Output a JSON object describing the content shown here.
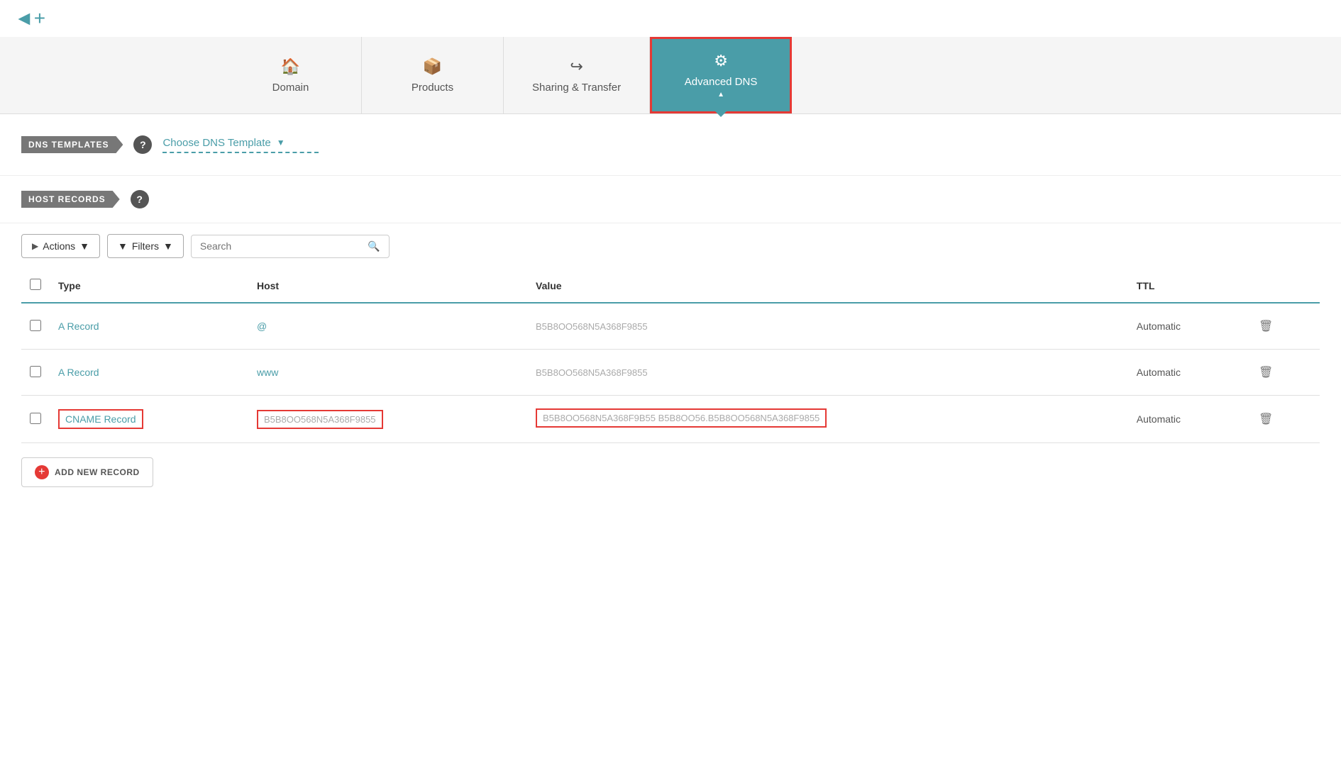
{
  "logo": {
    "arrow": "◄+"
  },
  "nav": {
    "tabs": [
      {
        "id": "domain",
        "label": "Domain",
        "icon": "🏠",
        "active": false
      },
      {
        "id": "products",
        "label": "Products",
        "icon": "📦",
        "active": false
      },
      {
        "id": "sharing-transfer",
        "label": "Sharing & Transfer",
        "icon": "🔀",
        "active": false
      },
      {
        "id": "advanced-dns",
        "label": "Advanced DNS",
        "icon": "⚙",
        "active": true
      }
    ]
  },
  "dns_templates": {
    "label": "DNS TEMPLATES",
    "placeholder": "Choose DNS Template",
    "help_title": "DNS Templates Help"
  },
  "host_records": {
    "label": "HOST RECORDS",
    "help_title": "Host Records Help"
  },
  "toolbar": {
    "actions_label": "Actions",
    "filters_label": "Filters",
    "search_placeholder": "Search"
  },
  "table": {
    "headers": [
      "",
      "Type",
      "Host",
      "Value",
      "TTL",
      ""
    ],
    "rows": [
      {
        "id": "row1",
        "type": "A Record",
        "host": "@",
        "value": "B5B8OO568N5A368F9855",
        "ttl": "Automatic",
        "highlighted": false
      },
      {
        "id": "row2",
        "type": "A Record",
        "host": "www",
        "value": "B5B8OO568N5A368F9855",
        "ttl": "Automatic",
        "highlighted": false
      },
      {
        "id": "row3",
        "type": "CNAME Record",
        "host": "B5B8OO568N5A368F9855",
        "value": "B5B8OO568N5A368F9B55 B5B8OO56.B5B8OO568N5A368F9855",
        "ttl": "Automatic",
        "highlighted": true
      }
    ]
  },
  "add_record": {
    "label": "ADD NEW RECORD"
  }
}
